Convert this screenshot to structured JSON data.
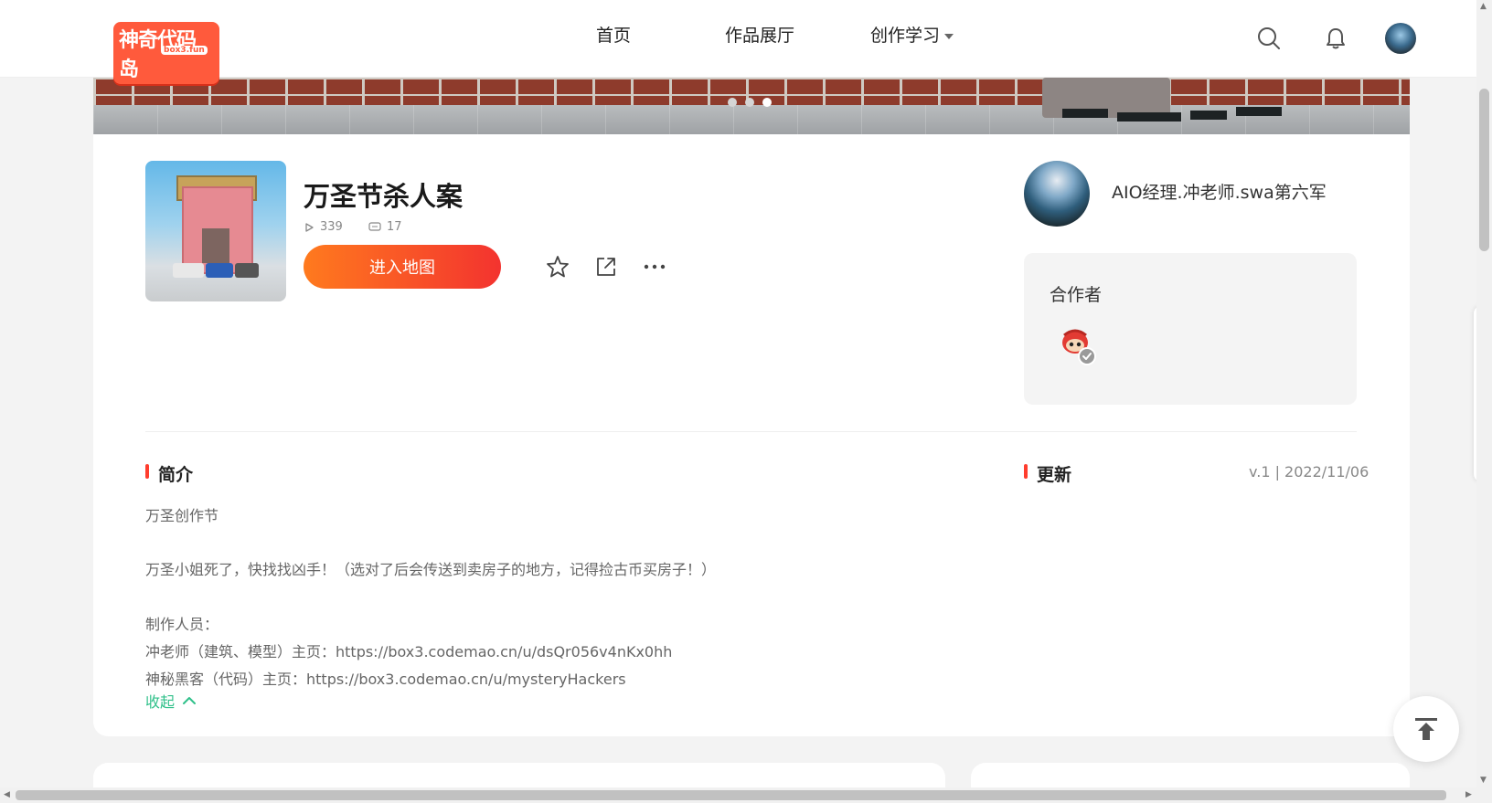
{
  "header": {
    "logo_text": "神奇代码岛",
    "logo_sub": "box3.fun",
    "nav": [
      "首页",
      "作品展厅",
      "创作学习"
    ]
  },
  "work": {
    "title": "万圣节杀人案",
    "plays": "339",
    "comments": "17",
    "enter_label": "进入地图"
  },
  "author": {
    "name": "AIO经理.冲老师.swa第六军"
  },
  "cooperators": {
    "title": "合作者"
  },
  "intro": {
    "title": "简介",
    "lines": [
      "万圣创作节",
      "万圣小姐死了，快找找凶手！（选对了后会传送到卖房子的地方，记得捡古币买房子！）",
      "制作人员：",
      "冲老师（建筑、模型）主页：https://box3.codemao.cn/u/dsQr056v4nKx0hh",
      "神秘黑客（代码）主页：https://box3.codemao.cn/u/mysteryHackers"
    ],
    "collapse_label": "收起"
  },
  "update": {
    "title": "更新",
    "version": "v.1 | 2022/11/06"
  },
  "colors": {
    "accent": "#ff3d2e",
    "button_start": "#ff7a1e",
    "button_end": "#f3332f",
    "collapse": "#30c08a"
  }
}
